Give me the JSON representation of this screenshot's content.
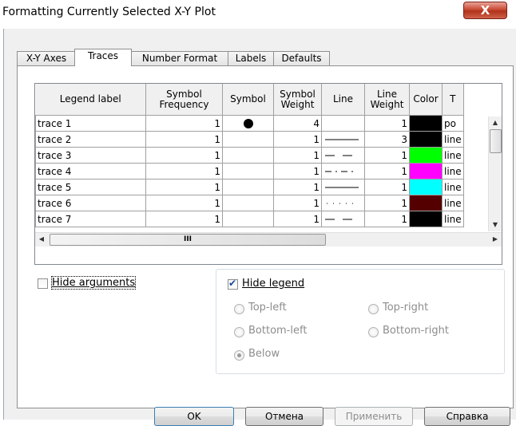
{
  "window": {
    "title": "Formatting Currently Selected X-Y Plot",
    "close_label": "X"
  },
  "tabs": [
    "X-Y Axes",
    "Traces",
    "Number Format",
    "Labels",
    "Defaults"
  ],
  "active_tab": "Traces",
  "grid": {
    "headers": [
      "Legend label",
      "Symbol Frequency",
      "Symbol",
      "Symbol Weight",
      "Line",
      "Line Weight",
      "Color",
      "T"
    ],
    "rows": [
      {
        "label": "trace 1",
        "freq": "1",
        "symbol": "dot",
        "symbol_weight": "4",
        "line": "none",
        "line_weight": "1",
        "color": "#000000",
        "type": "po"
      },
      {
        "label": "trace 2",
        "freq": "1",
        "symbol": "",
        "symbol_weight": "1",
        "line": "solid",
        "line_weight": "3",
        "color": "#000000",
        "type": "line"
      },
      {
        "label": "trace 3",
        "freq": "1",
        "symbol": "",
        "symbol_weight": "1",
        "line": "dash",
        "line_weight": "1",
        "color": "#00ff00",
        "type": "line"
      },
      {
        "label": "trace 4",
        "freq": "1",
        "symbol": "",
        "symbol_weight": "1",
        "line": "dashdot",
        "line_weight": "1",
        "color": "#ff00ff",
        "type": "line"
      },
      {
        "label": "trace 5",
        "freq": "1",
        "symbol": "",
        "symbol_weight": "1",
        "line": "solid",
        "line_weight": "1",
        "color": "#00ffff",
        "type": "line"
      },
      {
        "label": "trace 6",
        "freq": "1",
        "symbol": "",
        "symbol_weight": "1",
        "line": "dot",
        "line_weight": "1",
        "color": "#550000",
        "type": "line"
      },
      {
        "label": "trace 7",
        "freq": "1",
        "symbol": "",
        "symbol_weight": "1",
        "line": "dash",
        "line_weight": "1",
        "color": "#000000",
        "type": "line"
      }
    ],
    "hscroll_grip": "III"
  },
  "options": {
    "hide_arguments": {
      "label": "Hide arguments",
      "checked": false
    },
    "hide_legend": {
      "label": "Hide legend",
      "checked": true
    },
    "positions": [
      {
        "label": "Top-left",
        "selected": false
      },
      {
        "label": "Top-right",
        "selected": false
      },
      {
        "label": "Bottom-left",
        "selected": false
      },
      {
        "label": "Bottom-right",
        "selected": false
      },
      {
        "label": "Below",
        "selected": true
      }
    ]
  },
  "buttons": {
    "ok": "OK",
    "cancel": "Отмена",
    "apply": "Применить",
    "help": "Справка"
  }
}
